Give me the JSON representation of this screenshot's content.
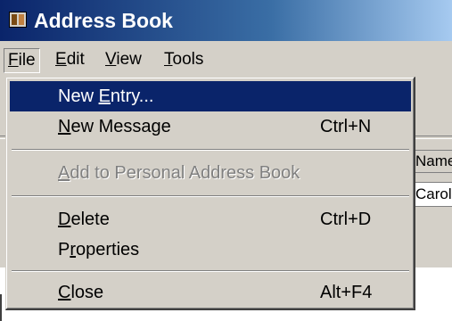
{
  "window": {
    "title": "Address Book",
    "icon": "address-book-icon"
  },
  "menubar": {
    "items": [
      {
        "label": "File",
        "underline": "F",
        "rest": "ile",
        "active": true
      },
      {
        "label": "Edit",
        "underline": "E",
        "rest": "dit"
      },
      {
        "label": "View",
        "underline": "V",
        "rest": "iew"
      },
      {
        "label": "Tools",
        "underline": "T",
        "rest": "ools"
      }
    ]
  },
  "file_menu": {
    "new_entry": {
      "pre": "New ",
      "underline": "E",
      "post": "ntry..."
    },
    "new_message": {
      "pre": "",
      "underline": "N",
      "post": "ew Message",
      "shortcut": "Ctrl+N"
    },
    "add_to_pab": {
      "pre": "",
      "underline": "A",
      "post": "dd to Personal Address Book"
    },
    "delete": {
      "pre": "",
      "underline": "D",
      "post": "elete",
      "shortcut": "Ctrl+D"
    },
    "properties": {
      "pre": "P",
      "underline": "r",
      "post": "operties"
    },
    "close": {
      "pre": "",
      "underline": "C",
      "post": "lose",
      "shortcut": "Alt+F4"
    }
  },
  "background": {
    "column_header": "Name",
    "row_text": "Carol"
  },
  "colors": {
    "highlight": "#0a246a",
    "face": "#d4d0c8"
  }
}
